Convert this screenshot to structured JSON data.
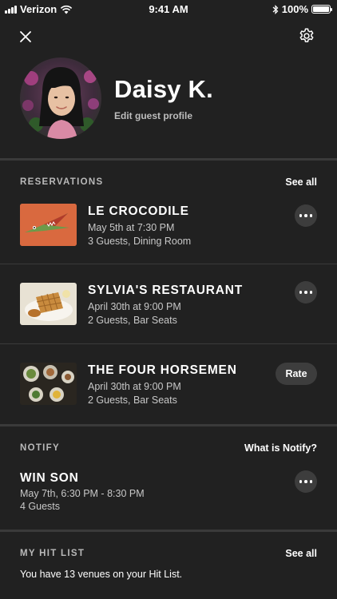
{
  "status_bar": {
    "carrier": "Verizon",
    "time": "9:41 AM",
    "battery": "100%",
    "battery_level": 1.0
  },
  "header": {
    "close_icon": "close-icon",
    "settings_icon": "gear-icon"
  },
  "profile": {
    "name": "Daisy K.",
    "edit_label": "Edit guest profile"
  },
  "reservations": {
    "label": "RESERVATIONS",
    "see_all": "See all",
    "items": [
      {
        "title": "LE CROCODILE",
        "date": "May 5th at 7:30 PM",
        "guests": "3 Guests, Dining Room",
        "action": "more"
      },
      {
        "title": "SYLVIA'S RESTAURANT",
        "date": "April 30th at 9:00 PM",
        "guests": "2 Guests, Bar Seats",
        "action": "more"
      },
      {
        "title": "THE FOUR HORSEMEN",
        "date": "April 30th at 9:00 PM",
        "guests": "2 Guests, Bar Seats",
        "action": "rate",
        "action_label": "Rate"
      }
    ]
  },
  "notify": {
    "label": "NOTIFY",
    "link": "What is Notify?",
    "item": {
      "title": "WIN SON",
      "time": "May 7th, 6:30 PM - 8:30 PM",
      "guests": "4 Guests"
    }
  },
  "hit_list": {
    "label": "MY HIT LIST",
    "see_all": "See all",
    "text": "You have 13 venues on your Hit List."
  }
}
